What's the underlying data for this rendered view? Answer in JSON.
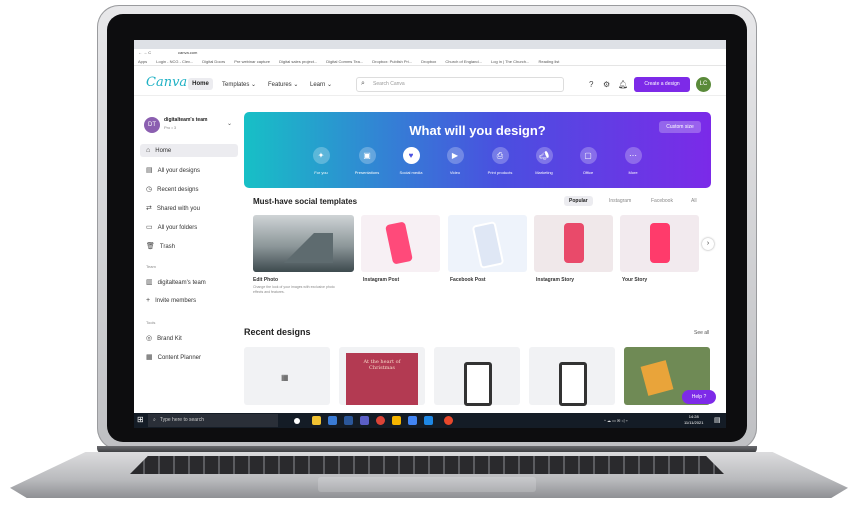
{
  "browser": {
    "url": "canva.com",
    "bookmarks": [
      "Apps",
      "Login - NCG - Clev...",
      "Digital Doors",
      "Pre webinar capture",
      "Digital sales project...",
      "Digital Comms Tea...",
      "Dropbox: Publish Pri...",
      "Dropbox",
      "Church of England...",
      "Log in | The Church...",
      "Reading list"
    ]
  },
  "header": {
    "logo": "Canva",
    "home": "Home",
    "templates": "Templates ⌄",
    "features": "Features ⌄",
    "learn": "Learn ⌄",
    "search_placeholder": "Search Canva",
    "create_button": "Create a design",
    "avatar_initials": "LC"
  },
  "sidebar": {
    "team_initials": "DT",
    "team_name": "digitalteam's team",
    "team_sub": "Pro • 3",
    "items": [
      {
        "label": "Home",
        "icon": "home-icon"
      },
      {
        "label": "All your designs",
        "icon": "designs-icon"
      },
      {
        "label": "Recent designs",
        "icon": "clock-icon"
      },
      {
        "label": "Shared with you",
        "icon": "shared-icon"
      },
      {
        "label": "All your folders",
        "icon": "folder-icon"
      },
      {
        "label": "Trash",
        "icon": "trash-icon"
      }
    ],
    "team_heading": "Team",
    "team_items": [
      {
        "label": "digitalteam's team",
        "icon": "team-icon"
      },
      {
        "label": "Invite members",
        "icon": "plus-icon"
      }
    ],
    "tools_heading": "Tools",
    "tools_items": [
      {
        "label": "Brand Kit",
        "icon": "brandkit-icon"
      },
      {
        "label": "Content Planner",
        "icon": "calendar-icon"
      }
    ]
  },
  "hero": {
    "title": "What will you design?",
    "custom_size": "Custom size",
    "categories": [
      "For you",
      "Presentations",
      "Social media",
      "Video",
      "Print products",
      "Marketing",
      "Office",
      "More"
    ]
  },
  "social": {
    "heading": "Must-have social templates",
    "filters": [
      "Popular",
      "Instagram",
      "Facebook",
      "All"
    ],
    "cards": [
      {
        "title": "Edit Photo",
        "desc": "Change the look of your images with exclusive photo effects and features."
      },
      {
        "title": "Instagram Post"
      },
      {
        "title": "Facebook Post"
      },
      {
        "title": "Instagram Story"
      },
      {
        "title": "Your Story"
      }
    ]
  },
  "recent": {
    "heading": "Recent designs",
    "see_all": "See all",
    "card2_text": "At the heart of Christmas"
  },
  "help": "Help ?",
  "taskbar": {
    "search": "Type here to search",
    "time": "14:28",
    "date": "11/11/2021"
  },
  "colors": {
    "accent": "#7d2ae8",
    "logo": "#1fb1c4",
    "hero_start": "#17c0c6",
    "hero_end": "#7b2ae8"
  }
}
